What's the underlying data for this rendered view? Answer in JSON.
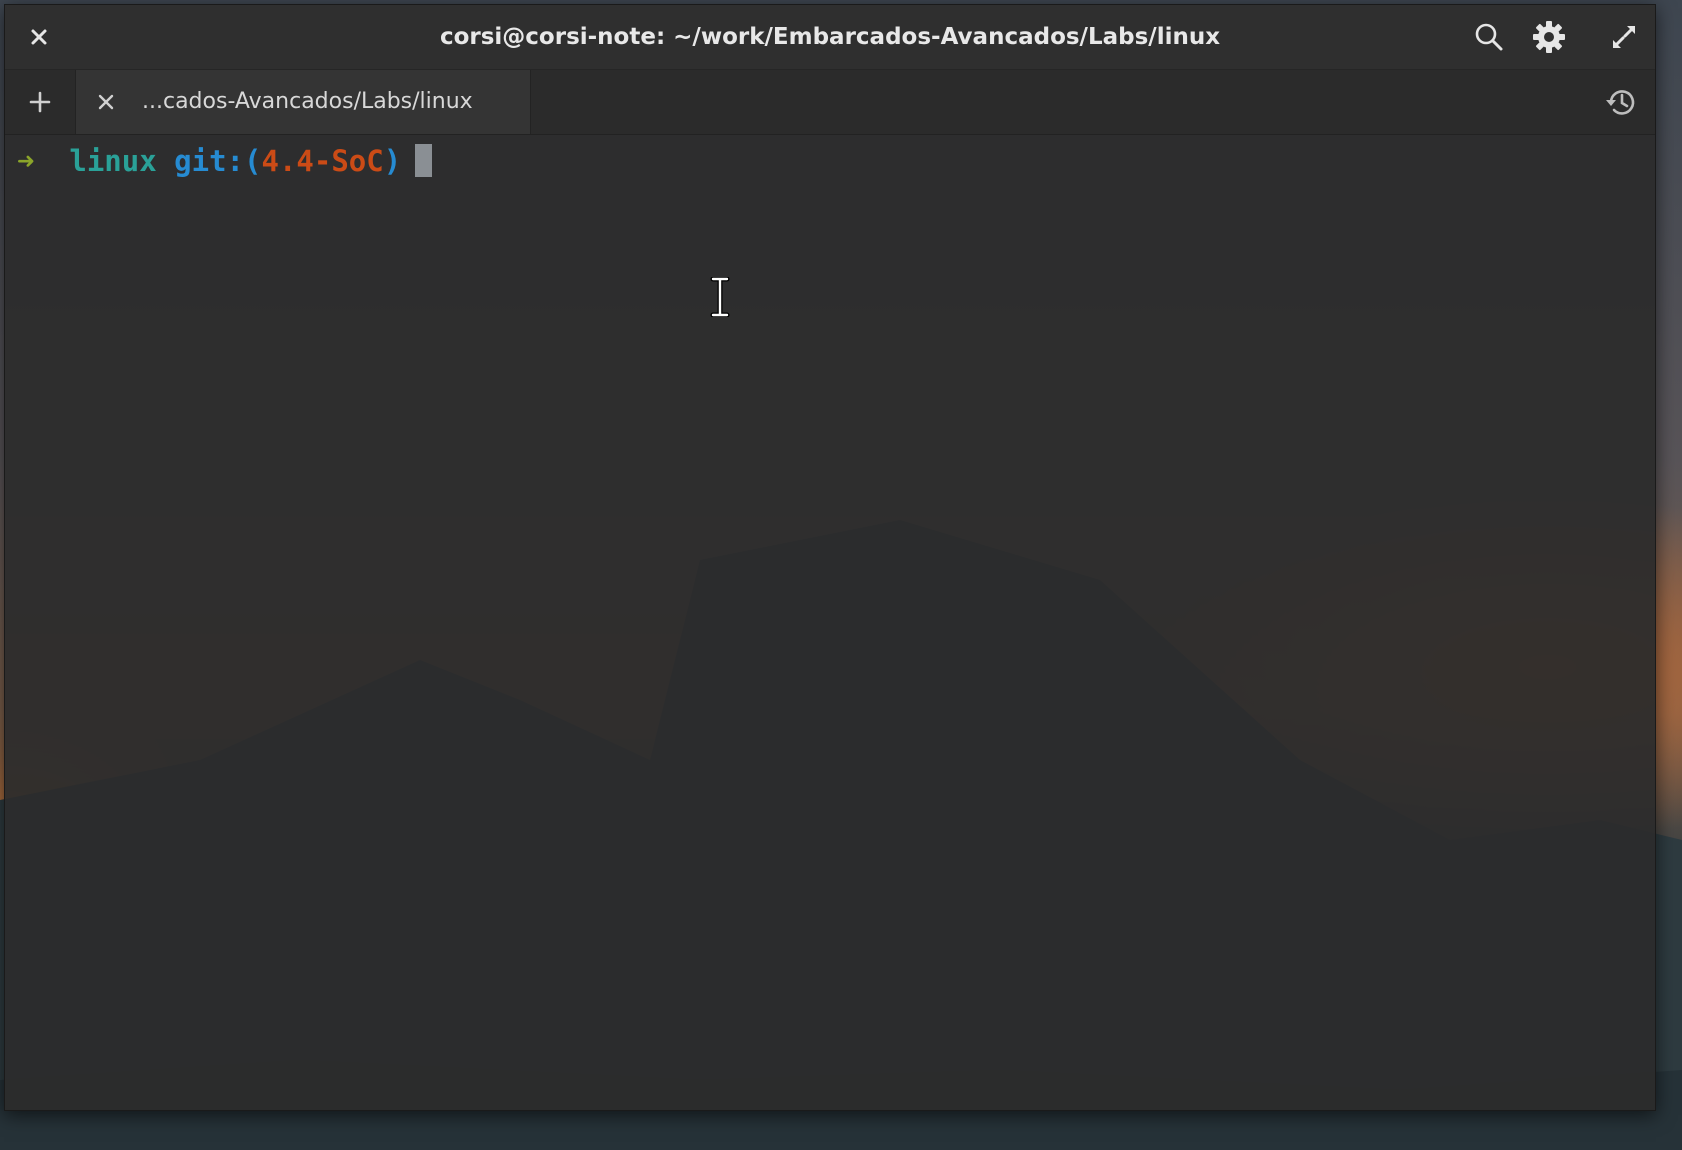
{
  "window": {
    "title": "corsi@corsi-note: ~/work/Embarcados-Avancados/Labs/linux",
    "close_icon": "close-icon",
    "search_icon": "search-icon",
    "settings_icon": "gear-icon",
    "fullscreen_icon": "fullscreen-icon"
  },
  "tabs": {
    "new_tab_icon": "plus-icon",
    "history_icon": "history-icon",
    "items": [
      {
        "label": "...cados-Avancados/Labs/linux",
        "close_icon": "close-icon"
      }
    ]
  },
  "terminal": {
    "prompt_arrow": "➜",
    "directory": "linux",
    "git_prefix": "git:(",
    "branch": "4.4-SoC",
    "git_suffix": ")"
  },
  "colors": {
    "arrow": "#8ba52a",
    "directory": "#2aa198",
    "git": "#268bd2",
    "branch": "#cb4b16",
    "terminal_bg": "#2c2c2c"
  }
}
